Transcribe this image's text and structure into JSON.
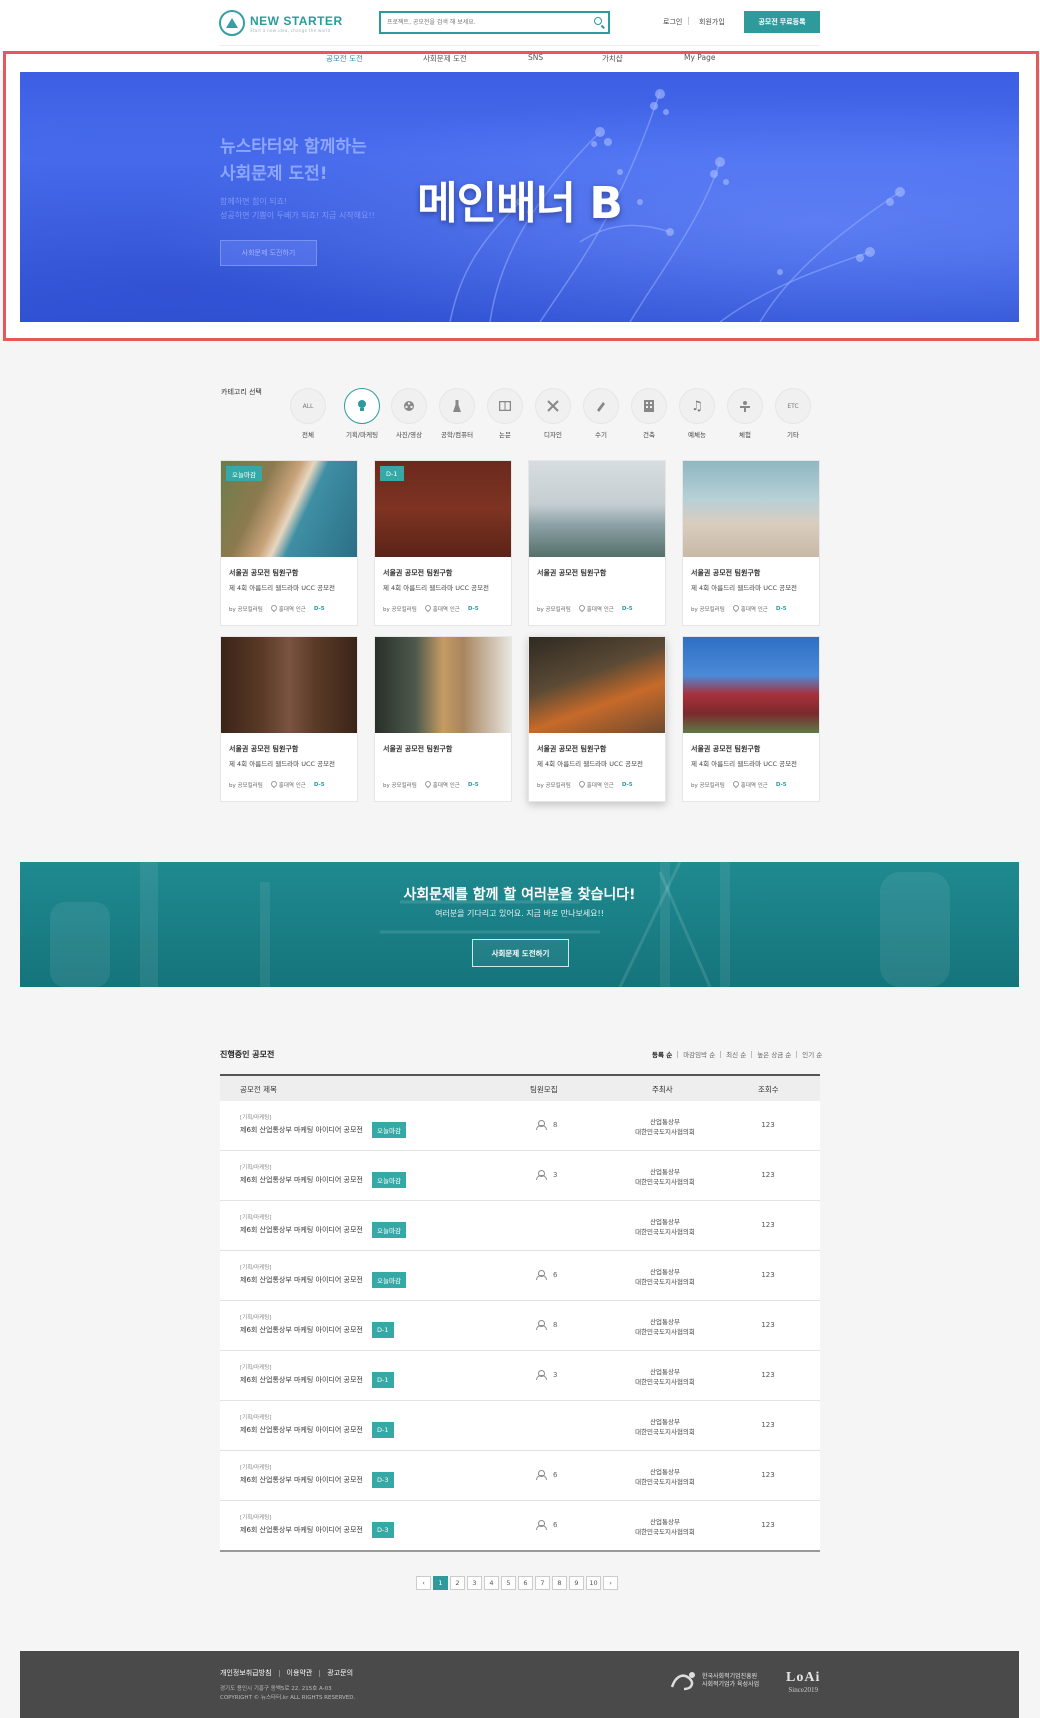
{
  "header": {
    "logo_title": "NEW STARTER",
    "logo_sub": "Start a new idea, change the world",
    "search_placeholder": "프로젝트, 공모전을 검색 해 보세요.",
    "login": "로그인",
    "signup": "회원가입",
    "register": "공모전 무료등록"
  },
  "nav": {
    "items": [
      "공모전 도전",
      "사회문제 도전",
      "SNS",
      "가치샵",
      "My Page"
    ],
    "active": 0
  },
  "banner": {
    "headline": "뉴스타터와 함께하는\n사회문제 도전!",
    "text": "함께하면 힘이 되죠!\n성공하면 기쁨이 두배가 되죠! 지금 시작해요!!",
    "button": "사회문제 도전하기",
    "title": "메인배너 B"
  },
  "category": {
    "label": "카테고리 선택",
    "items": [
      {
        "name": "전체",
        "icon": "ALL"
      },
      {
        "name": "기획/마케팅",
        "icon": "lightbulb-icon"
      },
      {
        "name": "사진/영상",
        "icon": "film-reel-icon"
      },
      {
        "name": "공학/컴퓨터",
        "icon": "flask-icon"
      },
      {
        "name": "논문",
        "icon": "book-icon"
      },
      {
        "name": "디자인",
        "icon": "design-tools-icon"
      },
      {
        "name": "수기",
        "icon": "pen-icon"
      },
      {
        "name": "건축",
        "icon": "building-icon"
      },
      {
        "name": "예체능",
        "icon": "music-note-icon"
      },
      {
        "name": "체험",
        "icon": "experience-icon"
      },
      {
        "name": "기타",
        "icon": "ETC"
      }
    ],
    "active": 1
  },
  "cards": [
    {
      "badge": "오늘마감",
      "title": "서울권 공모전 팀원구함",
      "sub": "제 4회 아름드리 웹드라마 UCC 공모전",
      "by": "by 공모킬러팀",
      "loc": "홍대역 인근",
      "dday": "D-5",
      "image": "aerial-beach"
    },
    {
      "badge": "D-1",
      "title": "서울권 공모전 팀원구함",
      "sub": "제 4회 아름드리 웹드라마 UCC 공모전",
      "by": "by 공모킬러팀",
      "loc": "홍대역 인근",
      "dday": "D-5",
      "image": "bicycle"
    },
    {
      "badge": "",
      "title": "서울권 공모전 팀원구함",
      "sub": "",
      "by": "by 공모킬러팀",
      "loc": "홍대역 인근",
      "dday": "D-5",
      "image": "foggy-coast"
    },
    {
      "badge": "",
      "title": "서울권 공모전 팀원구함",
      "sub": "제 4회 아름드리 웹드라마 UCC 공모전",
      "by": "by 공모킬러팀",
      "loc": "홍대역 인근",
      "dday": "D-5",
      "image": "beach-runner"
    },
    {
      "badge": "",
      "title": "서울권 공모전 팀원구함",
      "sub": "제 4회 아름드리 웹드라마 UCC 공모전",
      "by": "by 공모킬러팀",
      "loc": "홍대역 인근",
      "dday": "D-5",
      "image": "wooden-gate"
    },
    {
      "badge": "",
      "title": "서울권 공모전 팀원구함",
      "sub": "",
      "by": "by 공모킬러팀",
      "loc": "홍대역 인근",
      "dday": "D-5",
      "image": "dog-window"
    },
    {
      "badge": "",
      "title": "서울권 공모전 팀원구함",
      "sub": "제 4회 아름드리 웹드라마 UCC 공모전",
      "by": "by 공모킬러팀",
      "loc": "홍대역 인근",
      "dday": "D-5",
      "image": "autumn-tree"
    },
    {
      "badge": "",
      "title": "서울권 공모전 팀원구함",
      "sub": "제 4회 아름드리 웹드라마 UCC 공모전",
      "by": "by 공모킬러팀",
      "loc": "홍대역 인근",
      "dday": "D-5",
      "image": "red-house"
    }
  ],
  "recruit": {
    "title": "사회문제를 함께 할 여러분을 찾습니다!",
    "sub": "여러분을 기다리고 있어요. 지금 바로 만나보세요!!",
    "button": "사회문제 도전하기"
  },
  "list": {
    "title": "진행중인 공모전",
    "sorts": [
      "등록 순",
      "마감임박 순",
      "최신 순",
      "높은 상금 순",
      "인기 순"
    ],
    "columns": [
      "공모전 제목",
      "팀원모집",
      "주최사",
      "조회수"
    ],
    "rows": [
      {
        "cat": "[기획/마케팅]",
        "title": "제6회 산업통상부 마케팅 아이디어 공모전",
        "tag": "오늘마감",
        "team": "8",
        "host": "산업통상부\n대한민국도지사협의회",
        "views": "123"
      },
      {
        "cat": "[기획/마케팅]",
        "title": "제6회 산업통상부 마케팅 아이디어 공모전",
        "tag": "오늘마감",
        "team": "3",
        "host": "산업통상부\n대한민국도지사협의회",
        "views": "123"
      },
      {
        "cat": "[기획/마케팅]",
        "title": "제6회 산업통상부 마케팅 아이디어 공모전",
        "tag": "오늘마감",
        "team": "",
        "host": "산업통상부\n대한민국도지사협의회",
        "views": "123"
      },
      {
        "cat": "[기획/마케팅]",
        "title": "제6회 산업통상부 마케팅 아이디어 공모전",
        "tag": "오늘마감",
        "team": "6",
        "host": "산업통상부\n대한민국도지사협의회",
        "views": "123"
      },
      {
        "cat": "[기획/마케팅]",
        "title": "제6회 산업통상부 마케팅 아이디어 공모전",
        "tag": "D-1",
        "team": "8",
        "host": "산업통상부\n대한민국도지사협의회",
        "views": "123"
      },
      {
        "cat": "[기획/마케팅]",
        "title": "제6회 산업통상부 마케팅 아이디어 공모전",
        "tag": "D-1",
        "team": "3",
        "host": "산업통상부\n대한민국도지사협의회",
        "views": "123"
      },
      {
        "cat": "[기획/마케팅]",
        "title": "제6회 산업통상부 마케팅 아이디어 공모전",
        "tag": "D-1",
        "team": "",
        "host": "산업통상부\n대한민국도지사협의회",
        "views": "123"
      },
      {
        "cat": "[기획/마케팅]",
        "title": "제6회 산업통상부 마케팅 아이디어 공모전",
        "tag": "D-3",
        "team": "6",
        "host": "산업통상부\n대한민국도지사협의회",
        "views": "123"
      },
      {
        "cat": "[기획/마케팅]",
        "title": "제6회 산업통상부 마케팅 아이디어 공모전",
        "tag": "D-3",
        "team": "6",
        "host": "산업통상부\n대한민국도지사협의회",
        "views": "123"
      }
    ]
  },
  "pager": {
    "prev": "‹",
    "next": "›",
    "pages": [
      "1",
      "2",
      "3",
      "4",
      "5",
      "6",
      "7",
      "8",
      "9",
      "10"
    ],
    "active": 0
  },
  "footer": {
    "links": [
      "개인정보취급방침",
      "이용약관",
      "광고문의"
    ],
    "address": "경기도 용인시 기흥구 동백5로 22, 215호 A-03\nCOPYRIGHT © 뉴스타터.kr ALL RIGHTS RESERVED.",
    "org1": "한국사회적기업진흥원\n사회적기업가 육성사업",
    "org2": "LoAi",
    "org2_sub": "Since2019"
  },
  "colors": {
    "accent": "#2e9a9c",
    "banner": "#4367e6",
    "highlight_frame": "#e8575b"
  }
}
